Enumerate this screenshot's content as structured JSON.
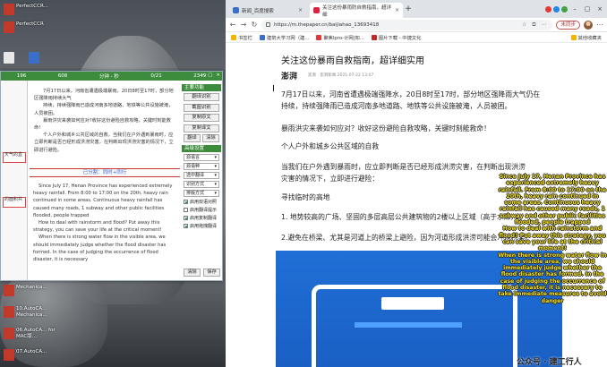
{
  "desktop": {
    "icons_top": [
      {
        "label": "PerfectCCR...",
        "color": "#c0392b"
      },
      {
        "label": "PerfectCCR",
        "color": "#c0392b"
      },
      {
        "label": "",
        "color": "#e8e8e8"
      },
      {
        "label": "",
        "color": "#3b6ec8"
      }
    ],
    "icons_bottom": [
      {
        "label": "Mechanica...",
        "color": "#c0392b"
      },
      {
        "label": "10.AutoCA... Mechanica...",
        "color": "#c0392b"
      },
      {
        "label": "06.AutoCA... for MAC版...",
        "color": "#c0392b"
      },
      {
        "label": "07.AutoCA...",
        "color": "#c0392b"
      }
    ]
  },
  "app": {
    "top_tabs": [
      "196",
      "608",
      "分钟 - 秒",
      "0/21",
      "2349"
    ],
    "left_marks": [
      "天气的直",
      "的面积共"
    ],
    "source_paragraphs": [
      "7月17日以来，河南省遭遇极端暴雨，20日8时至17时，部分地区强降雨持续大气",
      "持续，持续强降雨已造成河南多地道路、地铁等公共设施被淹，人员被困。",
      "暴雨洪灾来袭如何应对?收好这份避险自救攻略，关键时刻能救命!",
      "个人户外和城乡公共区域的自救，当我们在户外遇到暴雨时，应立即判断是否已经形成洪涝灾害，在判断出现洪涝灾害的情况下，立即进行避险。"
    ],
    "divider_text": "已分割：同时+同行",
    "translation_paragraphs": [
      "Since July 17, Henan Province has experienced extremely heavy rainfall. From 8:00 to 17:00 on the 20th, heavy rain continued in some areas. Continuous heavy rainfall has caused many roads, 1 subway and other public facilities flooded, people trapped",
      "How to deal with rainstorm and flood? Put away this strategy, you can save your life at the critical moment!",
      "When there is strong water flow in the visible area, we should immediately judge whether the flood disaster has formed. In the case of judging the occurrence of flood disaster, it is necessary"
    ],
    "sidebar": {
      "group1_title": "主要功能",
      "buttons1": [
        "翻译识别",
        "截图识别",
        "复制原文",
        "复制译文"
      ],
      "row_buttons": [
        "翻译",
        "清除"
      ],
      "group2_title": "高级设置",
      "selects": [
        {
          "label": "源语言",
          "value": "自动"
        },
        {
          "label": "源语种",
          "value": "翻"
        },
        {
          "label": "选中翻译",
          "value": "翻"
        },
        {
          "label": "识别方式",
          "value": "翻"
        },
        {
          "label": "排版方式",
          "value": "翻"
        }
      ],
      "checks": [
        {
          "label": "启用双语对照",
          "checked": true
        },
        {
          "label": "启用翻译提示",
          "checked": false
        },
        {
          "label": "启用复制翻译",
          "checked": true
        },
        {
          "label": "启用拖拽翻译",
          "checked": true
        }
      ],
      "footer_buttons": [
        "清除",
        "保存"
      ]
    }
  },
  "browser": {
    "tabs": [
      {
        "title": "新闻_百度搜索",
        "active": false,
        "color": "#3b6ec8"
      },
      {
        "title": "关注这份暴雨防自救指南，超详细",
        "active": true,
        "color": "#d24"
      }
    ],
    "url": "https://m.thepaper.cn/baijiahao_13693418",
    "update_button": "未同步",
    "bookmarks": [
      "书签栏",
      "建筑大学习网（建...",
      "聚焦lpro-计网|知...",
      "图片下载 - 中捷文化",
      "其他收藏夹"
    ],
    "article": {
      "title": "关注这份暴雨自救指南，超详细实用",
      "logo": "澎湃",
      "meta": "澎湃 · 澎湃新闻 2021-07-22 13:07",
      "lines": [
        "7月17日以来，河南省遭遇极端强降水，20日8时至17时，部分地区强降雨大气仍在",
        "持续，持续强降雨已造成河南多地道路、地铁等公共设施被淹，人员被困。",
        "暴雨洪灾来袭如何应对？收好这份避险自救攻略，关键时刻能救命！",
        "个人户外和城乡公共区域的自救",
        "当我们在户外遇到暴雨时，应立即判断是否已经形成洪涝灾害，在判断出现洪涝",
        "灾害的情况下，立即进行避险：",
        "寻找临时的高地",
        "1. 地势较高的广场、坚固的多层高层公共建筑物的2楼以上区域（高于水深）；",
        "2.避免在桥梁、尤其是河道上的桥梁上避险，因为河道形成洪涝可能会冲垮桥梁。"
      ]
    },
    "overlay_paragraphs": [
      "Since July 17, Henan Province has experienced extremely heavy rainfall. From 8:00 to 17:00 on the 20th, heavy rain continued in some areas. Continuous heavy rainfall has caused many roads, 1 subway and other public facilities flooded, people trapped",
      "How to deal with rainstorm and flood? Put away this strategy, you can save your life at the critical moment!",
      "When there is strong water flow in the visible area, we should immediately judge whether the flood disaster has formed. In the case of judging the occurrence of flood disaster, it is necessary to take immediate measures to avoid danger"
    ],
    "watermark": "公众号 · 建工行人"
  }
}
